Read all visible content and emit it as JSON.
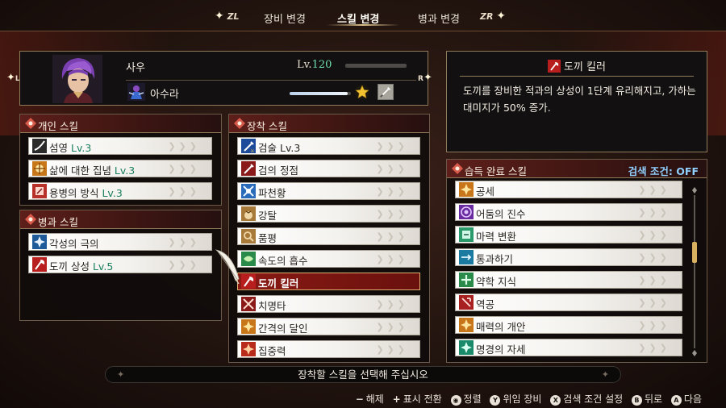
{
  "top_nav": {
    "left_trigger": "ZL",
    "right_trigger": "ZR",
    "tabs": [
      {
        "label": "장비 변경",
        "active": false
      },
      {
        "label": "스킬 변경",
        "active": true
      },
      {
        "label": "병과 변경",
        "active": false
      }
    ]
  },
  "character": {
    "name": "사우",
    "level_label": "Lv.",
    "level": "120",
    "class_name": "아수라",
    "class_progress": 0.95,
    "left_bumper": "L",
    "right_bumper": "R"
  },
  "description": {
    "title": "도끼 킬러",
    "text": "도끼를 장비한 적과의 상성이 1단계 유리해지고, 가하는 대미지가 50% 증가."
  },
  "personal_skills": {
    "title": "개인 스킬",
    "items": [
      {
        "name": "섬영 ",
        "lv": "Lv.3",
        "icon": "slash-icon"
      },
      {
        "name": "삶에 대한 집념 ",
        "lv": "Lv.3",
        "icon": "personal-skill-icon"
      },
      {
        "name": "용병의 방식 ",
        "lv": "Lv.3",
        "icon": "mercenary-icon"
      }
    ]
  },
  "class_skills": {
    "title": "병과 스킬",
    "items": [
      {
        "name": "각성의 극의",
        "lv": "",
        "icon": "awakening-icon"
      },
      {
        "name": "도끼 상성 ",
        "lv": "Lv.5",
        "icon": "axe-icon"
      }
    ]
  },
  "equipped_skills": {
    "title": "장착 스킬",
    "items": [
      {
        "name": "검술 Lv.3",
        "icon": "sword-icon",
        "selected": false
      },
      {
        "name": "검의 정점",
        "icon": "sword-peak-icon",
        "selected": false
      },
      {
        "name": "파천황",
        "icon": "pacheonhwang-icon",
        "selected": false
      },
      {
        "name": "강탈",
        "icon": "pouch-icon",
        "selected": false
      },
      {
        "name": "품평",
        "icon": "appraise-icon",
        "selected": false
      },
      {
        "name": "속도의 흡수",
        "icon": "speed-absorb-icon",
        "selected": false
      },
      {
        "name": "도끼 킬러",
        "icon": "axe-killer-icon",
        "selected": true
      },
      {
        "name": "치명타",
        "icon": "critical-icon",
        "selected": false
      },
      {
        "name": "간격의 달인",
        "icon": "range-master-icon",
        "selected": false
      },
      {
        "name": "집중력",
        "icon": "focus-icon",
        "selected": false
      }
    ]
  },
  "learned_skills": {
    "title": "습득 완료 스킬",
    "search_label": "검색 조건: OFF",
    "items": [
      {
        "name": "공세",
        "icon": "offense-icon"
      },
      {
        "name": "어둠의 진수",
        "icon": "dark-essence-icon"
      },
      {
        "name": "마력 변환",
        "icon": "mana-convert-icon"
      },
      {
        "name": "통과하기",
        "icon": "pass-through-icon"
      },
      {
        "name": "약학 지식",
        "icon": "pharmacy-icon"
      },
      {
        "name": "역공",
        "icon": "counter-icon"
      },
      {
        "name": "매력의 개안",
        "icon": "charm-icon"
      },
      {
        "name": "명경의 자세",
        "icon": "mirror-stance-icon"
      }
    ],
    "scroll_position": 0.35
  },
  "prompt": "장착할 스킬을 선택해 주십시오",
  "controls": [
    {
      "button": "−",
      "label": "해제"
    },
    {
      "button": "+",
      "label": "표시 전환"
    },
    {
      "button": "stick",
      "label": "정렬"
    },
    {
      "button": "Y",
      "label": "위임 장비"
    },
    {
      "button": "X",
      "label": "검색 조건 설정"
    },
    {
      "button": "B",
      "label": "뒤로"
    },
    {
      "button": "A",
      "label": "다음"
    }
  ],
  "colors": {
    "accent_gold": "#8f7a5a",
    "header_red": "#5e1f1a",
    "selected_red": "#8a1a14",
    "level_green": "#6fe0b0",
    "search_blue": "#8fd0ff"
  }
}
